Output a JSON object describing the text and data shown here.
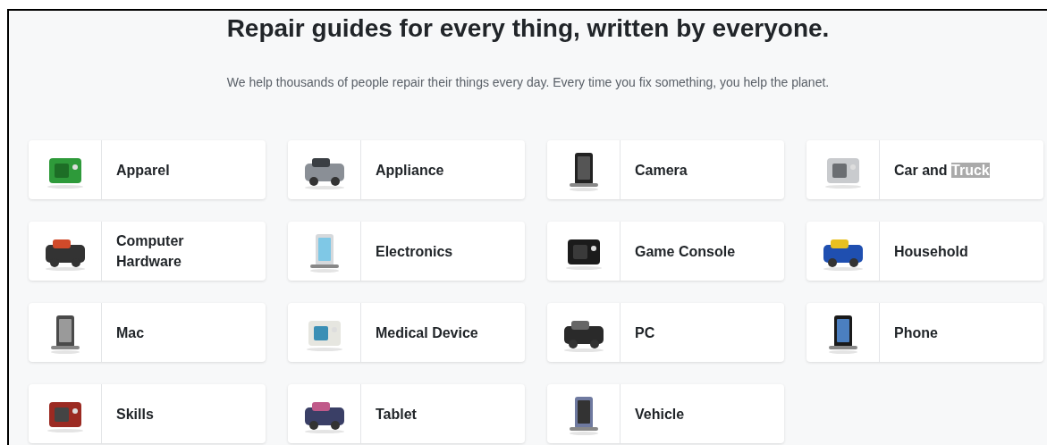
{
  "heading": "Repair guides for every thing, written by everyone.",
  "subtitle": "We help thousands of people repair their things every day. Every time you fix something, you help the planet.",
  "categories": [
    {
      "label_parts": [
        {
          "text": "Apparel",
          "highlighted": false
        }
      ]
    },
    {
      "label_parts": [
        {
          "text": "Appliance",
          "highlighted": false
        }
      ]
    },
    {
      "label_parts": [
        {
          "text": "Camera",
          "highlighted": false
        }
      ]
    },
    {
      "label_parts": [
        {
          "text": "Car and",
          "highlighted": false
        },
        {
          "text": "Truck",
          "highlighted": true
        }
      ]
    },
    {
      "label_parts": [
        {
          "text": "Computer Hardware",
          "highlighted": false
        }
      ]
    },
    {
      "label_parts": [
        {
          "text": "Electronics",
          "highlighted": false
        }
      ]
    },
    {
      "label_parts": [
        {
          "text": "Game Console",
          "highlighted": false
        }
      ]
    },
    {
      "label_parts": [
        {
          "text": "Household",
          "highlighted": false
        }
      ]
    },
    {
      "label_parts": [
        {
          "text": "Mac",
          "highlighted": false
        }
      ]
    },
    {
      "label_parts": [
        {
          "text": "Medical Device",
          "highlighted": false
        }
      ]
    },
    {
      "label_parts": [
        {
          "text": "PC",
          "highlighted": false
        }
      ]
    },
    {
      "label_parts": [
        {
          "text": "Phone",
          "highlighted": false
        }
      ]
    },
    {
      "label_parts": [
        {
          "text": "Skills",
          "highlighted": false
        }
      ]
    },
    {
      "label_parts": [
        {
          "text": "Tablet",
          "highlighted": false
        }
      ]
    },
    {
      "label_parts": [
        {
          "text": "Vehicle",
          "highlighted": false
        }
      ]
    }
  ]
}
